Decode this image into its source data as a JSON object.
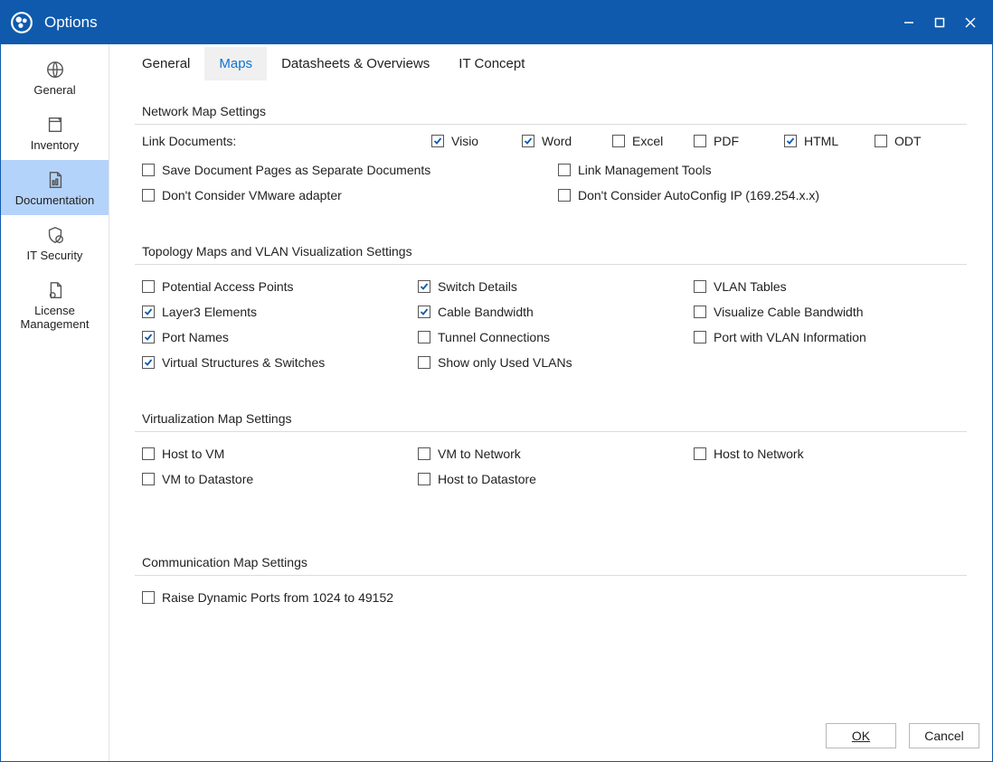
{
  "title": "Options",
  "sidebar": {
    "items": [
      {
        "label": "General"
      },
      {
        "label": "Inventory"
      },
      {
        "label": "Documentation"
      },
      {
        "label": "IT Security"
      },
      {
        "label": "License\nManagement"
      }
    ]
  },
  "tabs": {
    "general": "General",
    "maps": "Maps",
    "datasheets": "Datasheets & Overviews",
    "itconcept": "IT Concept"
  },
  "sections": {
    "network": {
      "title": "Network Map Settings",
      "linkDocumentsLabel": "Link Documents:",
      "visio": "Visio",
      "word": "Word",
      "excel": "Excel",
      "pdf": "PDF",
      "html": "HTML",
      "odt": "ODT",
      "savePages": "Save Document Pages as Separate Documents",
      "linkMgmt": "Link Management Tools",
      "vmware": "Don't Consider VMware adapter",
      "autoconfig": "Don't Consider AutoConfig IP (169.254.x.x)"
    },
    "topology": {
      "title": "Topology Maps and VLAN Visualization Settings",
      "pap": "Potential Access Points",
      "switch": "Switch Details",
      "vlanTables": "VLAN Tables",
      "layer3": "Layer3 Elements",
      "cableBw": "Cable Bandwidth",
      "visCableBw": "Visualize Cable Bandwidth",
      "portNames": "Port Names",
      "tunnel": "Tunnel Connections",
      "portVlan": "Port with VLAN Information",
      "virtStruct": "Virtual Structures & Switches",
      "usedVlans": "Show only Used VLANs"
    },
    "virtualization": {
      "title": "Virtualization Map Settings",
      "hostVm": "Host to VM",
      "vmNet": "VM to Network",
      "hostNet": "Host to Network",
      "vmDs": "VM to Datastore",
      "hostDs": "Host to Datastore"
    },
    "communication": {
      "title": "Communication Map Settings",
      "raisePorts": "Raise Dynamic Ports from 1024 to 49152"
    }
  },
  "buttons": {
    "ok": "OK",
    "cancel": "Cancel"
  }
}
